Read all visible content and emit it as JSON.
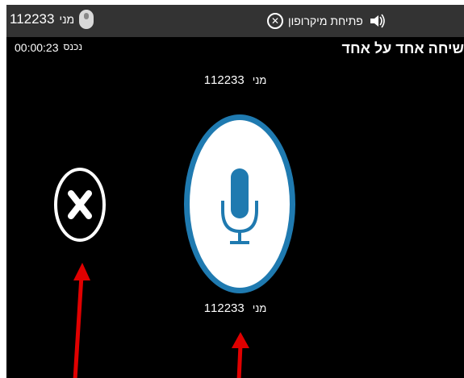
{
  "topbar": {
    "user_number": "112233",
    "user_name": "מני",
    "mic_label": "פתיחת מיקרופון",
    "icons": {
      "avatar": "avatar-icon",
      "close": "close-icon",
      "speaker": "speaker-icon"
    }
  },
  "call": {
    "title": "שיחה אחד על אחד",
    "timer_label": "נכנס",
    "timer": "00:00:23"
  },
  "speaker_top": {
    "number": "112233",
    "name": "מני"
  },
  "speaker_bottom": {
    "number": "112233",
    "name": "מני"
  },
  "controls": {
    "mic_button_icon": "microphone-icon",
    "end_button_icon": "close-circle-icon"
  },
  "colors": {
    "accent": "#1f7ab0",
    "background": "#000000",
    "topbar": "#333333",
    "annotation_arrow": "#e00000"
  }
}
